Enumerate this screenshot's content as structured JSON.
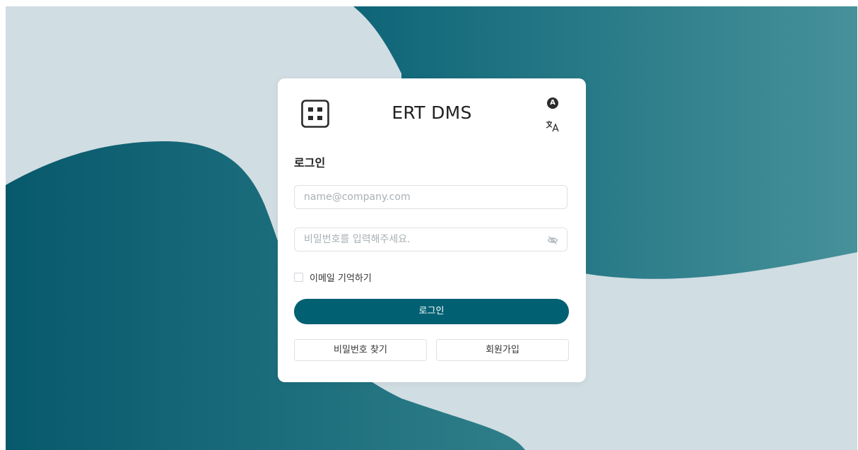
{
  "app": {
    "title": "ERT DMS",
    "theme_badge": "A",
    "icons": {
      "logo": "grid-logo-icon",
      "theme": "theme-toggle-icon",
      "language": "translate-icon",
      "password_visibility": "eye-off-icon"
    }
  },
  "login_form": {
    "heading": "로그인",
    "email": {
      "value": "",
      "placeholder": "name@company.com"
    },
    "password": {
      "value": "",
      "placeholder": "비밀번호를 입력해주세요."
    },
    "remember_label": "이메일 기억하기",
    "remember_checked": false,
    "submit_label": "로그인",
    "find_password_label": "비밀번호 찾기",
    "signup_label": "회원가입"
  },
  "colors": {
    "primary": "#016173",
    "background": "#d0dde2",
    "card": "#ffffff"
  }
}
